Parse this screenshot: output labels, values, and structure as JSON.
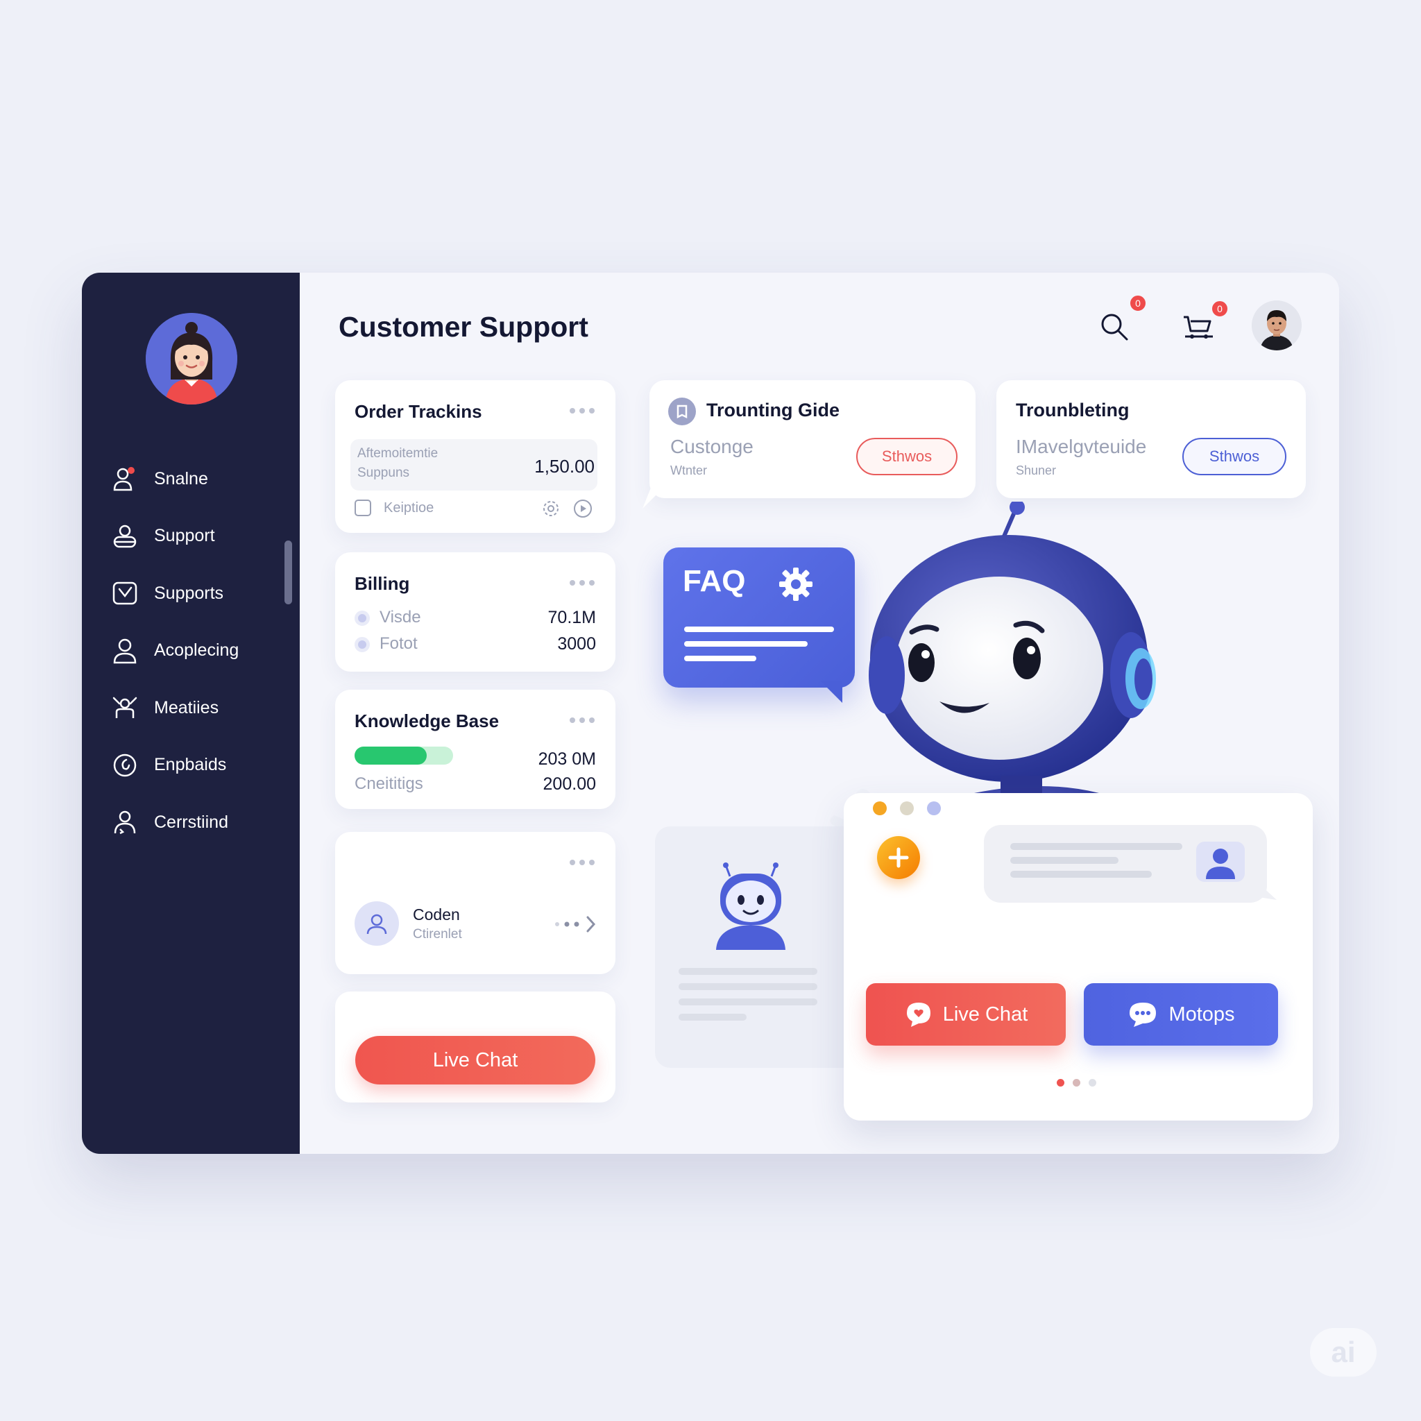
{
  "header": {
    "title": "Customer Support",
    "search_badge": "0",
    "cart_badge": "0"
  },
  "sidebar": {
    "items": [
      {
        "label": "Snalne",
        "icon": "user-alert-icon"
      },
      {
        "label": "Support",
        "icon": "headset-icon"
      },
      {
        "label": "Supports",
        "icon": "chart-icon"
      },
      {
        "label": "Acoplecing",
        "icon": "person-icon"
      },
      {
        "label": "Meatiies",
        "icon": "people-icon"
      },
      {
        "label": "Enpbaids",
        "icon": "clock-icon"
      },
      {
        "label": "Cerrstiind",
        "icon": "users-icon"
      }
    ]
  },
  "order_tracking": {
    "title": "Order Trackins",
    "row_line1": "Aftemoitemtie",
    "row_line2": "Suppuns",
    "amount": "1,50.00",
    "checkbox_label": "Keiptioe"
  },
  "billing": {
    "title": "Billing",
    "rows": [
      {
        "label": "Visde",
        "value": "70.1M"
      },
      {
        "label": "Fotot",
        "value": "3000"
      }
    ]
  },
  "knowledge_base": {
    "title": "Knowledge Base",
    "progress": 0.73,
    "value1": "203 0M",
    "label2": "Cneititigs",
    "value2": "200.00"
  },
  "contact_card": {
    "name": "Coden",
    "subtitle": "Ctirenlet"
  },
  "live_chat_card": {
    "button_label": "Live Chat"
  },
  "guide_card": {
    "title": "Trounting Gide",
    "subtitle": "Custonge",
    "small": "Wtnter",
    "button": "Sthwos",
    "accent": "#e85b5b"
  },
  "troubleshooting_card": {
    "title": "Trounbleting",
    "subtitle": "IMavelgvteuide",
    "small": "Shuner",
    "button": "Sthwos",
    "accent": "#4c5fd5"
  },
  "faq": {
    "label": "FAQ"
  },
  "chat_panel": {
    "live_chat_label": "Live Chat",
    "motops_label": "Motops",
    "live_chat_color": "#ef5350",
    "motops_color": "#4f63e0"
  },
  "watermark": "ai"
}
